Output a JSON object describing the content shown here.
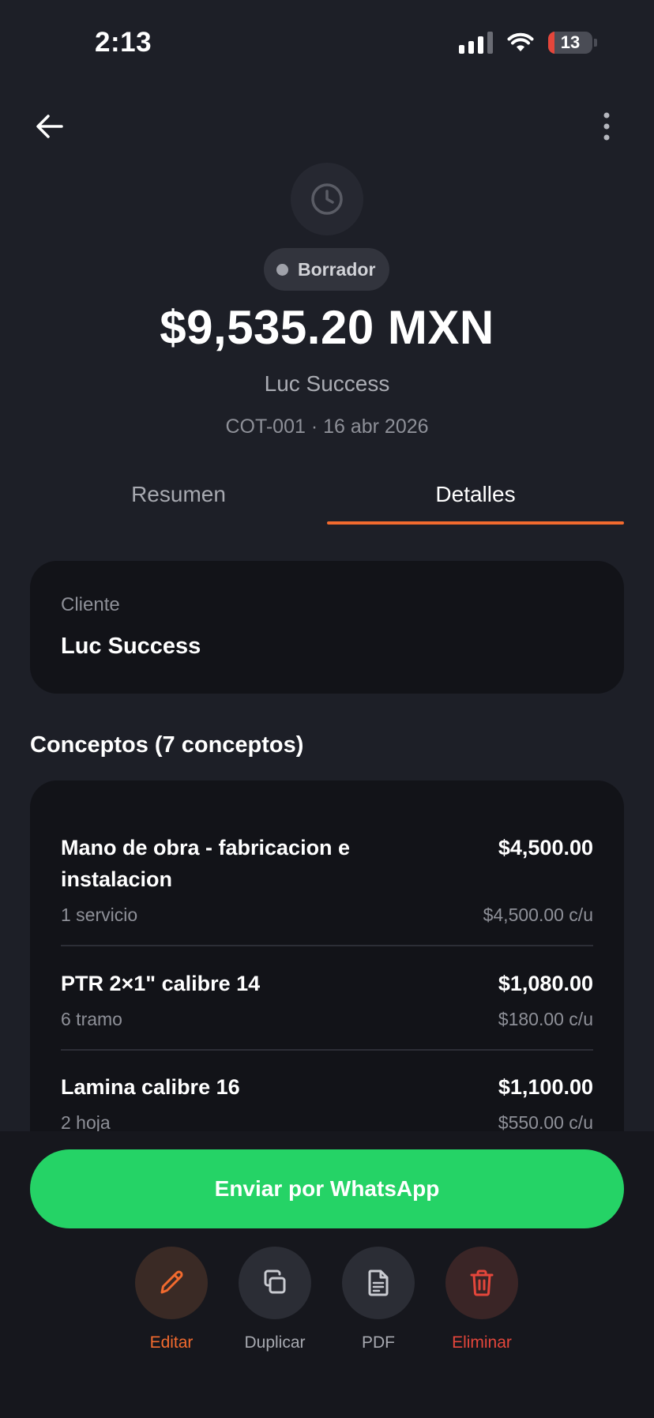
{
  "status_bar": {
    "time": "2:13",
    "battery": "13"
  },
  "icons": {
    "back": "arrow-left-icon",
    "more": "more-vertical-icon",
    "status": "clock-icon",
    "edit": "pencil-icon",
    "duplicate": "copy-icon",
    "pdf": "document-icon",
    "delete": "trash-icon"
  },
  "quote": {
    "status": "Borrador",
    "amount": "$9,535.20 MXN",
    "client": "Luc Success",
    "meta": "COT-001 · 16 abr 2026"
  },
  "tabs": [
    {
      "label": "Resumen",
      "active": false
    },
    {
      "label": "Detalles",
      "active": true
    }
  ],
  "client_card": {
    "label": "Cliente",
    "value": "Luc Success"
  },
  "concepts": {
    "title": "Conceptos (7 conceptos)",
    "items": [
      {
        "name": "Mano de obra - fabricacion e instalacion",
        "total": "$4,500.00",
        "qty": "1 servicio",
        "unit": "$4,500.00 c/u"
      },
      {
        "name": "PTR 2×1\" calibre 14",
        "total": "$1,080.00",
        "qty": "6 tramo",
        "unit": "$180.00 c/u"
      },
      {
        "name": "Lamina calibre 16",
        "total": "$1,100.00",
        "qty": "2 hoja",
        "unit": "$550.00 c/u"
      }
    ]
  },
  "actions": {
    "whatsapp": "Enviar por WhatsApp",
    "edit": "Editar",
    "duplicate": "Duplicar",
    "pdf": "PDF",
    "delete": "Eliminar"
  },
  "colors": {
    "background": "#1d1f27",
    "accent": "#f26a2e",
    "whatsapp": "#25d366",
    "danger": "#e4463b"
  }
}
